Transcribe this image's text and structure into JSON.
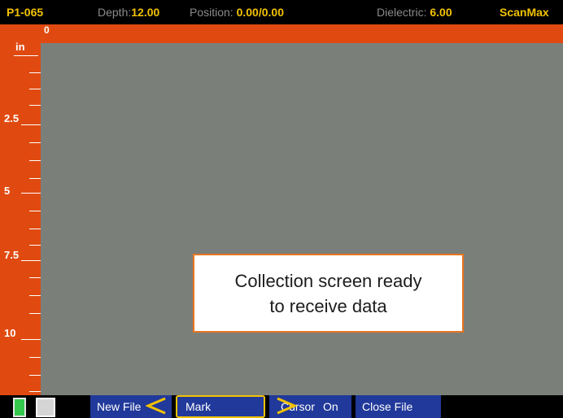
{
  "status_bar": {
    "file_id": "P1-065",
    "depth_label": "Depth:",
    "depth_value": "12.00",
    "position_label": "Position:",
    "position_value": "0.00/0.00",
    "dielectric_label": "Dielectric:",
    "dielectric_value": "6.00",
    "brand": "ScanMax"
  },
  "ruler": {
    "horizontal_zero": "0",
    "unit": "in",
    "labels": [
      "2.5",
      "5",
      "7.5",
      "10"
    ]
  },
  "callout": {
    "line1": "Collection screen ready",
    "line2": "to receive data"
  },
  "softkeys": {
    "new_file": "New File",
    "mark": "Mark",
    "cursor": "Cursor",
    "cursor_state": "On",
    "close_file": "Close File"
  },
  "colors": {
    "ruler": "#e04a10",
    "scan_background": "#7b7f7a",
    "highlight": "#f2c200",
    "softkey": "#21399a",
    "battery_green": "#35c84d"
  },
  "icons": [
    "battery-icon",
    "battery-empty-icon",
    "left-arrow-icon",
    "right-arrow-icon"
  ]
}
